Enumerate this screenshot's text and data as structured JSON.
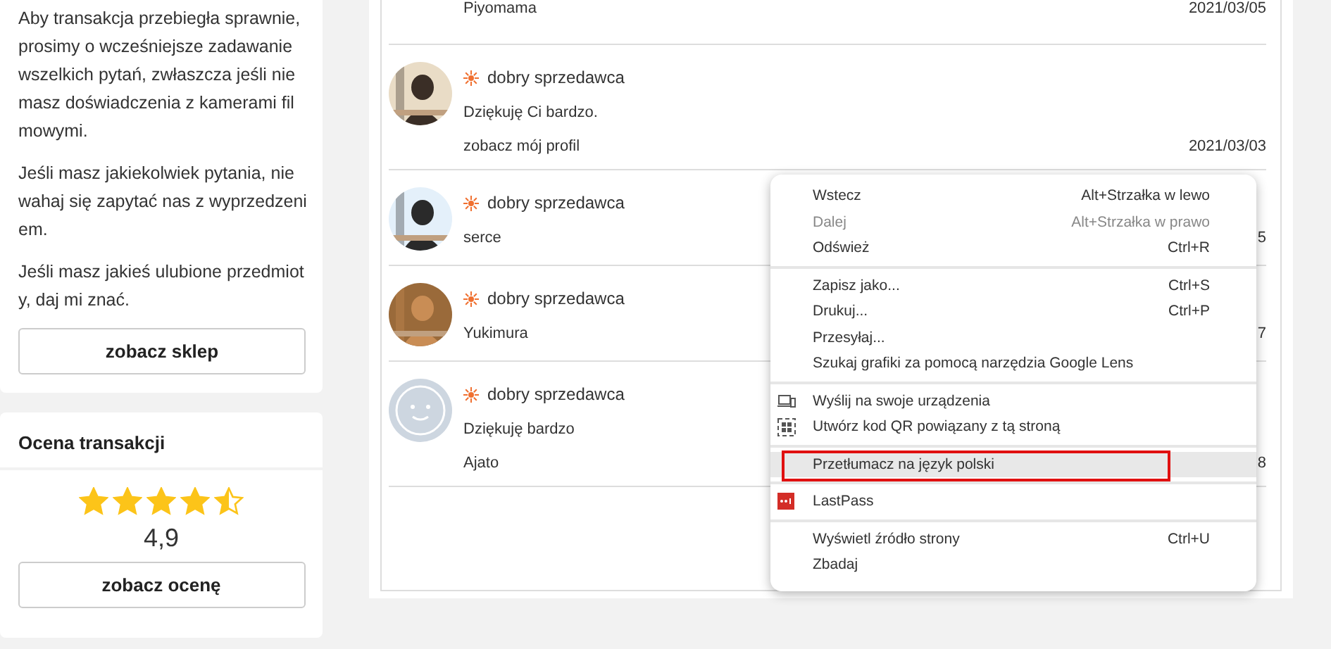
{
  "shop_card": {
    "paragraphs": [
      "Aby transakcja przebiegła sprawnie, prosimy o wcześniejsze zadawanie wszelkich pytań, zwłaszcza jeśli nie masz doświadczenia z kamerami filmowymi.",
      "Jeśli masz jakiekolwiek pytania, nie wahaj się zapytać nas z wyprzedzeniem.",
      "Jeśli masz jakieś ulubione przedmioty, daj mi znać."
    ],
    "button": "zobacz sklep"
  },
  "rating_card": {
    "title": "Ocena transakcji",
    "stars": 4.5,
    "score": "4,9",
    "button": "zobacz ocenę"
  },
  "reviews": [
    {
      "kind": "text_only",
      "name": "Piyomama",
      "date": "2021/03/05"
    },
    {
      "badge": "dobry sprzedawca",
      "comment": "Dziękuję Ci bardzo.",
      "name": "zobacz mój profil",
      "date": "2021/03/03"
    },
    {
      "badge": "dobry sprzedawca",
      "name": "serce",
      "date": "5"
    },
    {
      "badge": "dobry sprzedawca",
      "name": "Yukimura",
      "date": "7"
    },
    {
      "kind": "default_avatar",
      "badge": "dobry sprzedawca",
      "comment": "Dziękuję bardzo",
      "name": "Ajato",
      "date": "8"
    }
  ],
  "context_menu": {
    "groups": [
      {
        "items": [
          {
            "label": "Wstecz",
            "shortcut": "Alt+Strzałka w lewo",
            "disabled": false,
            "highlighted": false,
            "kind": "plain"
          },
          {
            "label": "Dalej",
            "shortcut": "Alt+Strzałka w prawo",
            "disabled": true,
            "highlighted": false,
            "kind": "plain"
          },
          {
            "label": "Odśwież",
            "shortcut": "Ctrl+R",
            "disabled": false,
            "highlighted": false,
            "kind": "plain"
          }
        ]
      },
      {
        "items": [
          {
            "label": "Zapisz jako...",
            "shortcut": "Ctrl+S",
            "disabled": false,
            "highlighted": false,
            "kind": "plain"
          },
          {
            "label": "Drukuj...",
            "shortcut": "Ctrl+P",
            "disabled": false,
            "highlighted": false,
            "kind": "plain"
          },
          {
            "label": "Przesyłaj...",
            "disabled": false,
            "highlighted": false,
            "kind": "plain"
          },
          {
            "label": "Szukaj grafiki za pomocą narzędzia Google Lens",
            "disabled": false,
            "highlighted": false,
            "kind": "plain"
          }
        ]
      },
      {
        "items": [
          {
            "label": "Wyślij na swoje urządzenia",
            "disabled": false,
            "highlighted": false,
            "kind": "devices"
          },
          {
            "label": "Utwórz kod QR powiązany z tą stroną",
            "disabled": false,
            "highlighted": false,
            "kind": "qr"
          }
        ]
      },
      {
        "items": [
          {
            "label": "Przetłumacz na język polski",
            "disabled": false,
            "highlighted": true,
            "kind": "plain"
          }
        ]
      },
      {
        "items": [
          {
            "label": "LastPass",
            "disabled": false,
            "highlighted": false,
            "kind": "lastpass"
          }
        ]
      },
      {
        "items": [
          {
            "label": "Wyświetl źródło strony",
            "shortcut": "Ctrl+U",
            "disabled": false,
            "highlighted": false,
            "kind": "plain"
          },
          {
            "label": "Zbadaj",
            "disabled": false,
            "highlighted": false,
            "kind": "plain"
          }
        ]
      }
    ]
  }
}
